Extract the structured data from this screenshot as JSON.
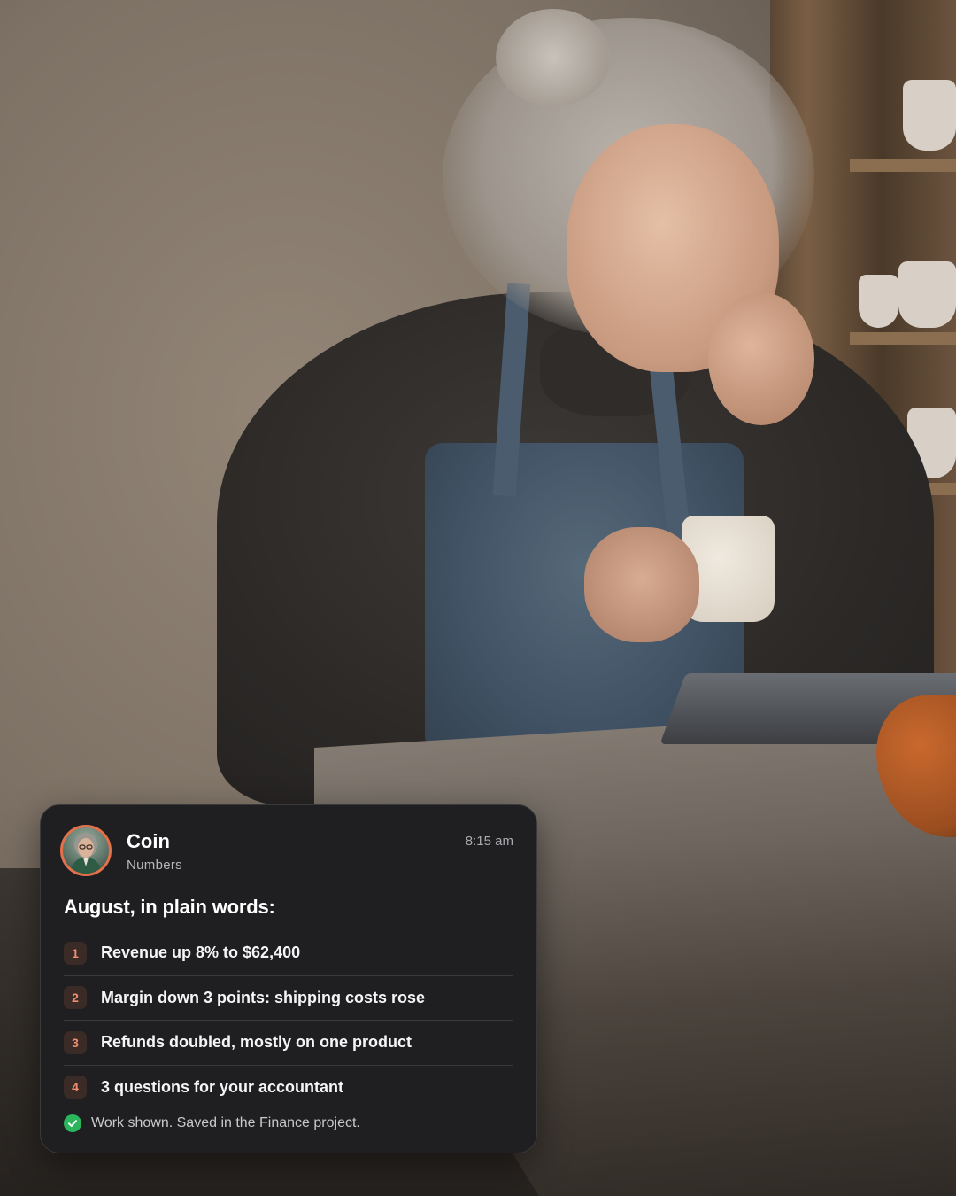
{
  "notification": {
    "sender_name": "Coin",
    "sender_role": "Numbers",
    "time": "8:15 am",
    "headline": "August, in plain words:",
    "items": [
      {
        "number": "1",
        "text": "Revenue up 8% to $62,400"
      },
      {
        "number": "2",
        "text": "Margin down 3 points: shipping costs rose"
      },
      {
        "number": "3",
        "text": "Refunds doubled, mostly on one product"
      },
      {
        "number": "4",
        "text": "3 questions for your accountant"
      }
    ],
    "footer": "Work shown. Saved in the Finance project.",
    "footer_icon": "check-circle-icon",
    "colors": {
      "card_background": "#1f1f21",
      "avatar_ring": "#e4704b",
      "number_badge_text": "#ef8e70",
      "check_green": "#2bb55c"
    }
  }
}
